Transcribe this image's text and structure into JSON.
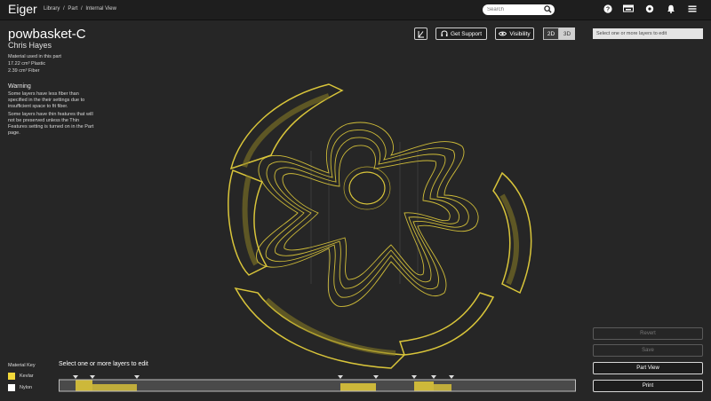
{
  "header": {
    "brand": "Eiger",
    "breadcrumbs": [
      "Library",
      "/",
      "Part",
      "/",
      "Internal View"
    ],
    "search_placeholder": "Search",
    "icons": [
      "help-icon",
      "printer-icon",
      "settings-icon",
      "bell-icon",
      "menu-icon"
    ]
  },
  "part": {
    "title": "powbasket-C",
    "author": "Chris Hayes",
    "material_heading": "Material used in this part",
    "plastic": "17.22 cm³ Plastic",
    "fiber": "2.39 cm³ Fiber"
  },
  "warning": {
    "title": "Warning",
    "line1": "Some layers have less fiber than specified in the their settings due to insufficient space to fit fiber.",
    "line2": "Some layers have thin features that will not be preserved unless the Thin Features setting is turned on in the Part page."
  },
  "toolbar": {
    "get_support": "Get Support",
    "visibility": "Visibility",
    "view_2d": "2D",
    "view_3d": "3D",
    "layer_select_placeholder": "Select one or more layers to edit"
  },
  "actions": {
    "revert": "Revert",
    "save": "Save",
    "part_view": "Part View",
    "print": "Print"
  },
  "material_key": {
    "title": "Material Key",
    "items": [
      {
        "label": "Kevlar",
        "color": "#f2d83a"
      },
      {
        "label": "Nylon",
        "color": "#ffffff"
      }
    ]
  },
  "layer_bar": {
    "label": "Select one or more layers to edit",
    "fiber_color": "#cdb83a",
    "track_color": "#4a4a4a"
  },
  "colors": {
    "accent_yellow": "#d9c53a",
    "background": "#262626"
  }
}
